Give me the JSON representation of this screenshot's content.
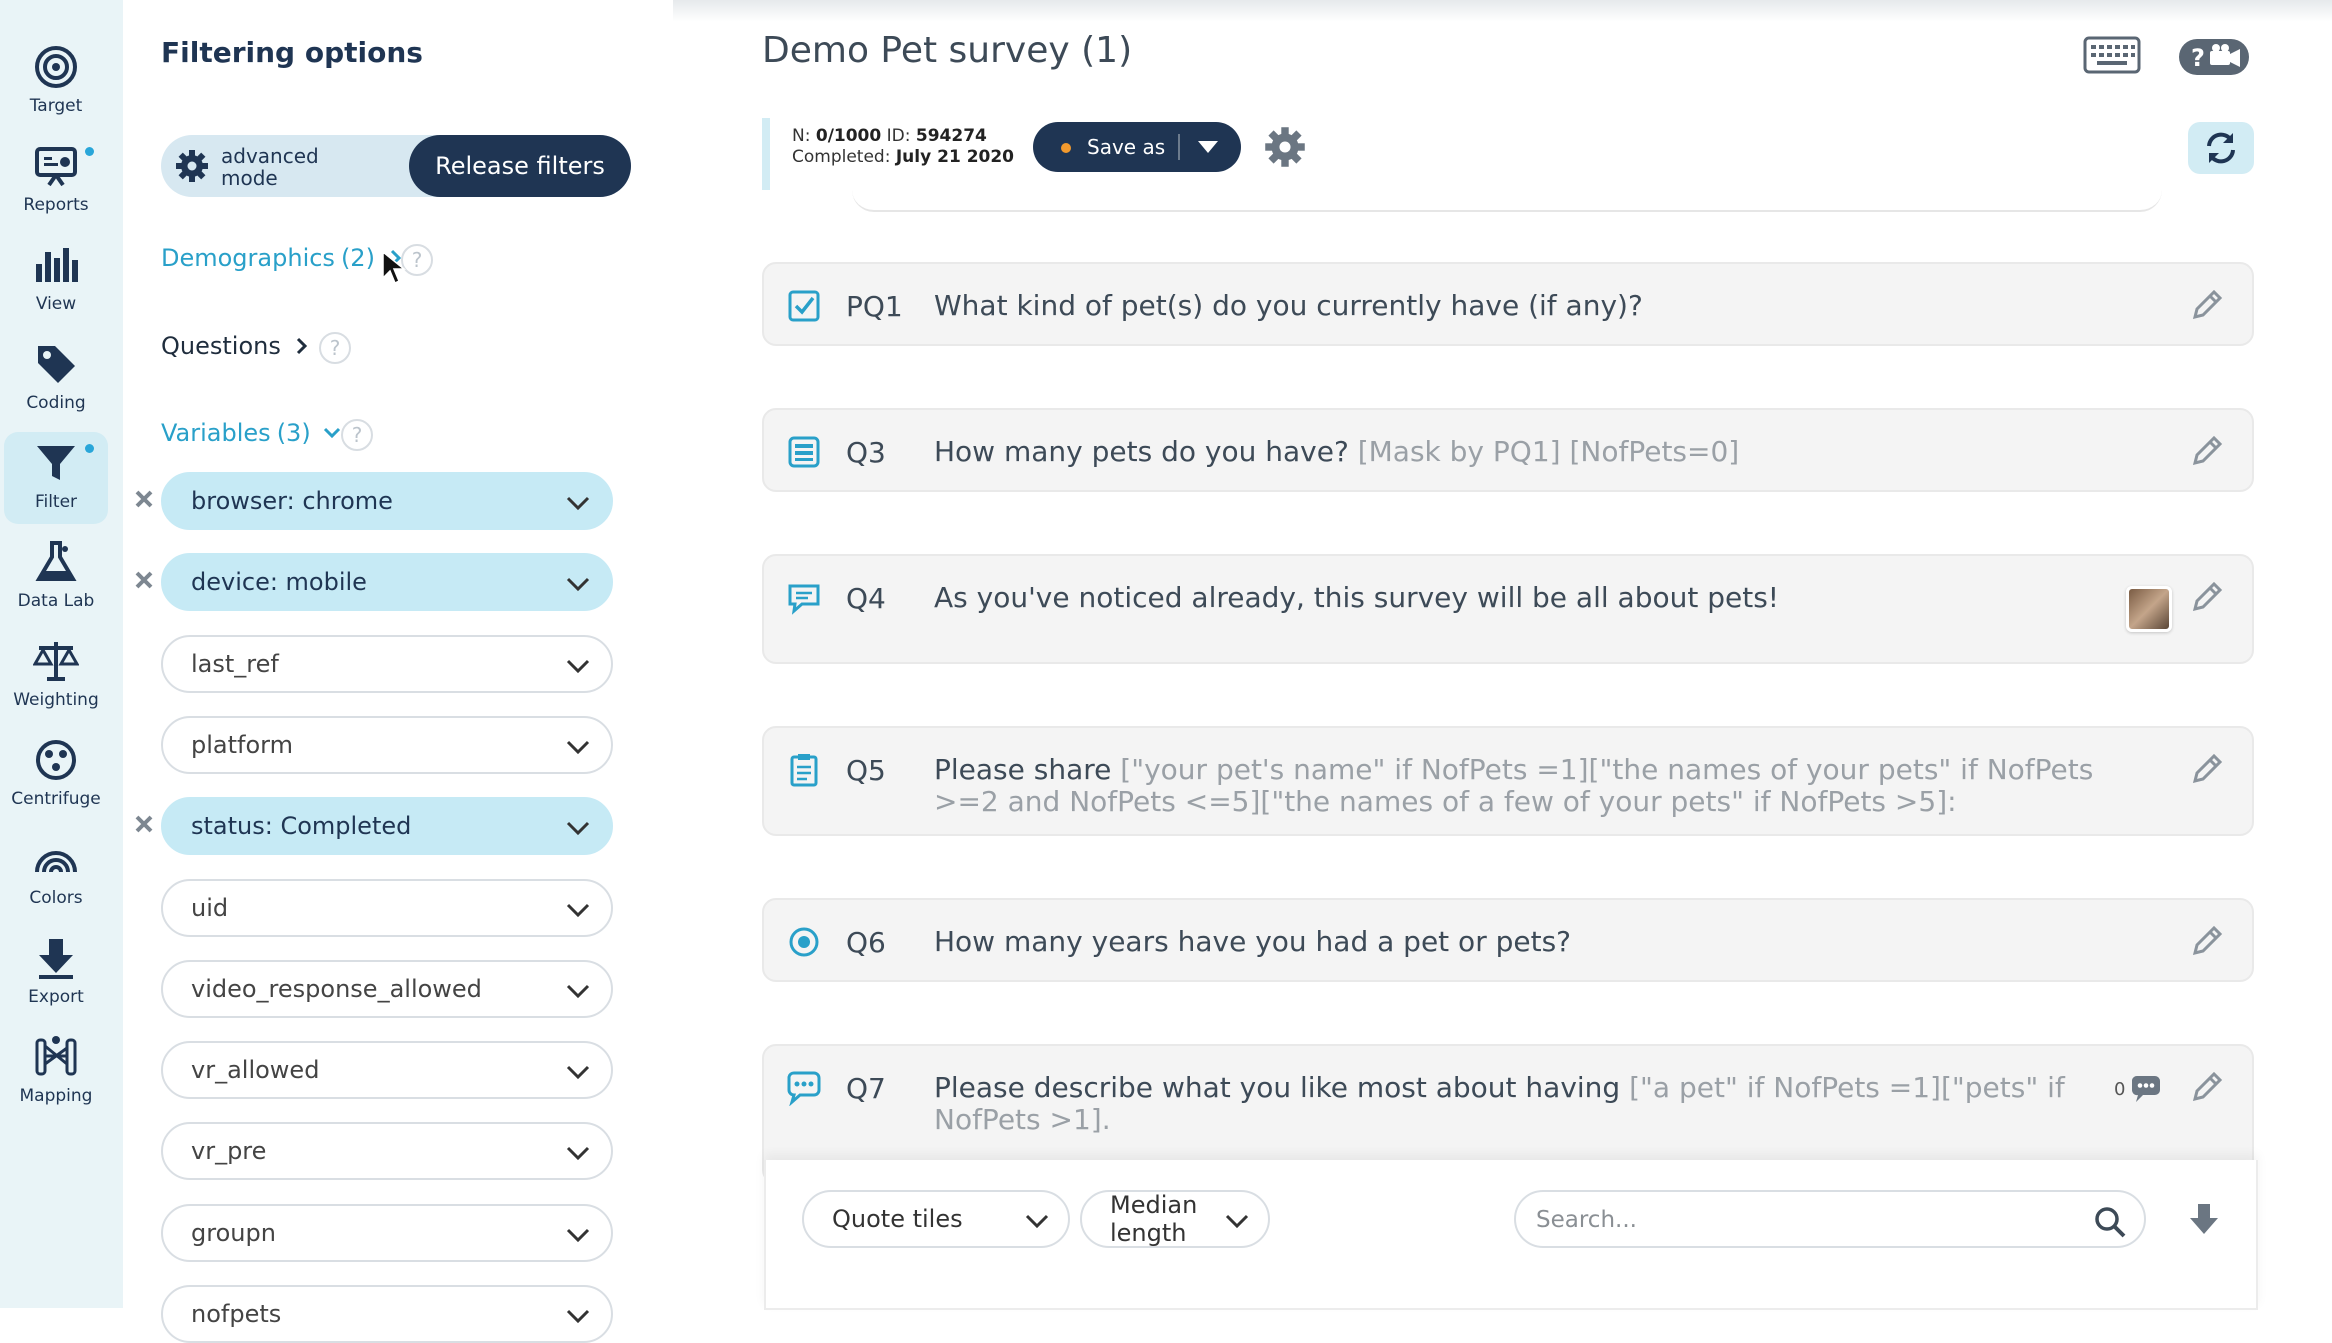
{
  "colors": {
    "rail_bg": "#e9f4f7",
    "navy": "#1f3553",
    "accent_blue": "#29a0c9",
    "pill_active": "#c6eaf5",
    "orange_dot": "#f29a2e"
  },
  "rail": {
    "items": [
      {
        "label": "Target",
        "icon": "target-icon"
      },
      {
        "label": "Reports",
        "icon": "presentation-icon"
      },
      {
        "label": "View",
        "icon": "bar-chart-icon"
      },
      {
        "label": "Coding",
        "icon": "tag-icon"
      },
      {
        "label": "Filter",
        "icon": "funnel-icon"
      },
      {
        "label": "Data Lab",
        "icon": "flask-icon"
      },
      {
        "label": "Weighting",
        "icon": "scale-icon"
      },
      {
        "label": "Centrifuge",
        "icon": "centrifuge-icon"
      },
      {
        "label": "Colors",
        "icon": "rainbow-icon"
      },
      {
        "label": "Export",
        "icon": "download-arrow-icon"
      },
      {
        "label": "Mapping",
        "icon": "mapping-icon"
      }
    ]
  },
  "panel": {
    "title": "Filtering options",
    "mode_label": "advanced mode",
    "release_label": "Release filters",
    "demographics": {
      "label": "Demographics",
      "count": "(2)"
    },
    "questions": {
      "label": "Questions"
    },
    "variables": {
      "label": "Variables",
      "count": "(3)"
    },
    "help": "?",
    "variable_items": [
      {
        "label": "browser: chrome",
        "active": true
      },
      {
        "label": "device: mobile",
        "active": true
      },
      {
        "label": "last_ref",
        "active": false
      },
      {
        "label": "platform",
        "active": false
      },
      {
        "label": "status: Completed",
        "active": true
      },
      {
        "label": "uid",
        "active": false
      },
      {
        "label": "video_response_allowed",
        "active": false
      },
      {
        "label": "vr_allowed",
        "active": false
      },
      {
        "label": "vr_pre",
        "active": false
      },
      {
        "label": "groupn",
        "active": false
      },
      {
        "label": "nofpets",
        "active": false
      }
    ]
  },
  "main": {
    "survey_title": "Demo Pet survey (1)",
    "info": {
      "n_label": "N:",
      "n_value": "0/1000",
      "id_label": "ID:",
      "id_value": "594274",
      "completed_label": "Completed:",
      "completed_value": "July 21 2020"
    },
    "save_label": "Save as",
    "questions": [
      {
        "id": "PQ1",
        "text": "What kind of pet(s) do you currently have (if any)?",
        "muted": "",
        "icon": "checkbox-icon"
      },
      {
        "id": "Q3",
        "text": "How many pets do you have? ",
        "muted": "[Mask by PQ1] [NofPets=0]",
        "icon": "list-icon"
      },
      {
        "id": "Q4",
        "text": "As you've noticed already, this survey will be all about pets!",
        "muted": "",
        "icon": "speech-icon"
      },
      {
        "id": "Q5",
        "text": "Please share ",
        "muted": "[\"your pet's name\" if NofPets =1][\"the names of your pets\" if NofPets >=2 and NofPets <=5][\"the names of a few of your pets\" if NofPets >5]:",
        "icon": "clipboard-icon"
      },
      {
        "id": "Q6",
        "text": "How many years have you had a pet or pets?",
        "muted": "",
        "icon": "radio-icon"
      },
      {
        "id": "Q7",
        "text": "Please describe what you like most about having ",
        "muted": "[\"a pet\" if NofPets =1][\"pets\" if NofPets >1].",
        "icon": "chat-icon"
      }
    ],
    "q7_comment_count": "0",
    "controls": {
      "view_select": "Quote tiles",
      "sort_select": "Median length",
      "search_placeholder": "Search..."
    }
  }
}
